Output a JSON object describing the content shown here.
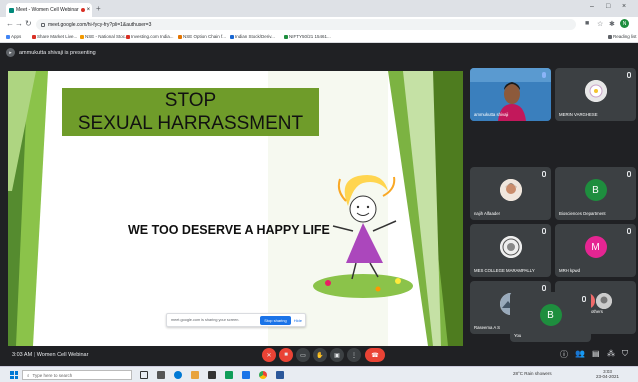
{
  "browser": {
    "tab_title": "Meet - Women Cell Webinar",
    "tab_close": "×",
    "new_tab": "+",
    "url": "meet.google.com/hi-fycy-fry?pli=1&authuser=3",
    "window_controls": [
      "–",
      "□",
      "×"
    ],
    "avatar_letter": "N",
    "bookmarks": [
      {
        "label": "Apps",
        "color": "#4285f4"
      },
      {
        "label": "Share Market Live...",
        "color": "#d93025"
      },
      {
        "label": "NSE - National Stoc...",
        "color": "#f29900"
      },
      {
        "label": "Investing.com India...",
        "color": "#d93025"
      },
      {
        "label": "NSE Option Chain f...",
        "color": "#e37400"
      },
      {
        "label": "Indian Stock/Deriv...",
        "color": "#1967d2"
      },
      {
        "label": "NIFTY50/21 15461...",
        "color": "#1e8e3e"
      }
    ],
    "reading_list": "Reading list"
  },
  "meet": {
    "presenter": "ammukutta shivaji is presenting",
    "slide": {
      "line1": "STOP",
      "line2": "SEXUAL HARRASSMENT",
      "line3": "WE TOO DESERVE A HAPPY LIFE"
    },
    "share_bar": {
      "text": "meet.google.com is sharing your screen.",
      "stop": "Stop sharing",
      "hide": "Hide"
    },
    "tiles": [
      {
        "name": "ammukutta shivaji",
        "kind": "video"
      },
      {
        "name": "MERIN VARGHESE",
        "kind": "photo-flower"
      },
      {
        "name": "najih Alfaader",
        "kind": "photo-face"
      },
      {
        "name": "Biosciences Department",
        "letter": "B",
        "color": "#1e8e3e"
      },
      {
        "name": "MES COLLEGE MARAMPALLY",
        "kind": "photo-logo"
      },
      {
        "name": "MRH kpwd",
        "letter": "M",
        "color": "#e52592"
      },
      {
        "name": "Raseema A S",
        "kind": "photo-landscape"
      },
      {
        "name": "79 others",
        "letter": "A",
        "color": "#f06a6a"
      },
      {
        "name": "You",
        "letter": "B",
        "color": "#1e8e3e"
      }
    ],
    "time": "3:03 AM",
    "meeting_name": "Women Cell Webinar"
  },
  "taskbar": {
    "search_placeholder": "Type here to search",
    "weather": "28°C  Rain showers",
    "clock": "3:03",
    "date": "23-04-2021"
  }
}
